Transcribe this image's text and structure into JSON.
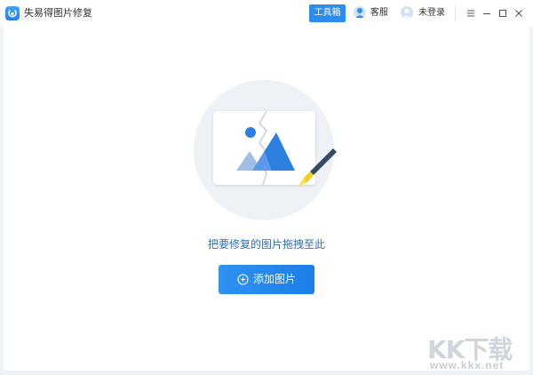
{
  "window": {
    "title": "失易得图片修复",
    "logo_icon": "app-logo-icon",
    "controls": [
      "menu-icon",
      "minimize-icon",
      "maximize-icon",
      "close-icon"
    ]
  },
  "header": {
    "toolbox_label": "工具箱",
    "service_label": "客服",
    "login_label": "未登录"
  },
  "main": {
    "illustration_icon": "broken-image-repair-icon",
    "hint": "把要修复的图片拖拽至此",
    "add_button_label": "添加图片",
    "add_icon": "plus-circle-icon"
  },
  "watermark": {
    "brand": "KK下载",
    "url": "www.kkx.net"
  },
  "colors": {
    "accent": "#2d8cf0",
    "hint_text": "#2d6fb4",
    "brush_handle": "#344a66",
    "brush_tip": "#f5d216"
  }
}
